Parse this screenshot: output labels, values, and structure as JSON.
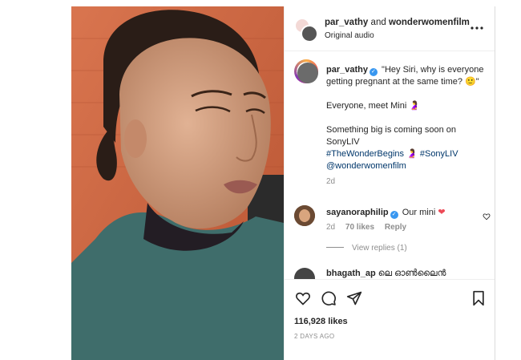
{
  "post": {
    "header": {
      "author": "par_vathy",
      "connector": "and",
      "collaborator": "wonderwomenfilm",
      "audio": "Original audio"
    },
    "caption": {
      "username": "par_vathy",
      "quote": "\"Hey Siri, why is everyone getting pregnant at the same time? 🙂\"",
      "line2": "Everyone, meet Mini 🤰",
      "line3": "Something big is coming soon on SonyLIV",
      "hashtag1": "#TheWonderBegins",
      "pregnant_emoji": "🤰",
      "hashtag2": "#SonyLIV",
      "mention": "@wonderwomenfilm",
      "time": "2d"
    },
    "comments": [
      {
        "username": "sayanoraphilip",
        "text": "Our mini",
        "heart": "❤",
        "time": "2d",
        "likes": "70 likes",
        "reply": "Reply",
        "view_replies": "View replies (1)"
      },
      {
        "username": "bhagath_ap",
        "text": "ലെ ഓൺലൈൻ"
      }
    ],
    "likes": "116,928 likes",
    "time_ago": "2 DAYS AGO",
    "icons": {
      "more": "more-horizontal-icon",
      "like": "heart-outline-icon",
      "comment": "comment-icon",
      "share": "paper-plane-icon",
      "save": "bookmark-icon",
      "verified": "verified-badge-icon"
    },
    "colors": {
      "link": "#00376b",
      "verified": "#3897f0",
      "muted": "#8e8e8e",
      "heart": "#ed4956"
    }
  }
}
